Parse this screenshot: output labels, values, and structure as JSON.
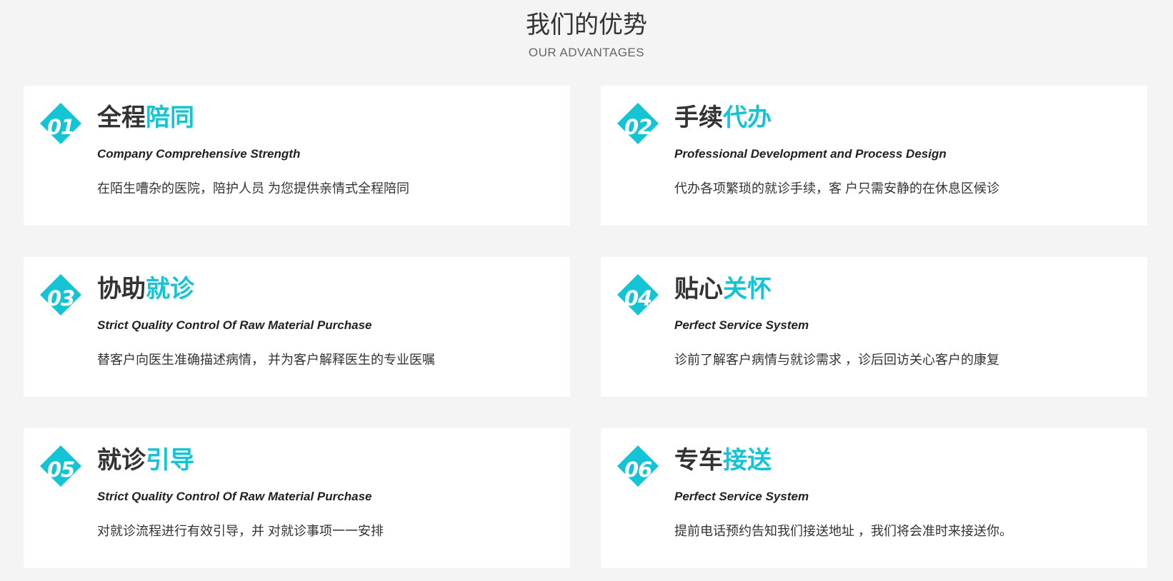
{
  "section": {
    "title": "我们的优势",
    "subtitle": "OUR ADVANTAGES"
  },
  "colors": {
    "accent": "#13c4d4",
    "background": "#f4f4f4",
    "card": "#ffffff",
    "text": "#333333"
  },
  "cards": [
    {
      "number": "01",
      "title_dark": "全程",
      "title_accent": "陪同",
      "subtitle_en": "Company Comprehensive Strength",
      "description": "在陌生嘈杂的医院，陪护人员 为您提供亲情式全程陪同"
    },
    {
      "number": "02",
      "title_dark": "手续",
      "title_accent": "代办",
      "subtitle_en": "Professional Development and Process Design",
      "description": "代办各项繁琐的就诊手续，客 户只需安静的在休息区候诊"
    },
    {
      "number": "03",
      "title_dark": "协助",
      "title_accent": "就诊",
      "subtitle_en": "Strict Quality Control Of Raw Material Purchase",
      "description": "替客户向医生准确描述病情， 并为客户解释医生的专业医嘱"
    },
    {
      "number": "04",
      "title_dark": "贴心",
      "title_accent": "关怀",
      "subtitle_en": "Perfect Service System",
      "description": "诊前了解客户病情与就诊需求 ，诊后回访关心客户的康复"
    },
    {
      "number": "05",
      "title_dark": "就诊",
      "title_accent": "引导",
      "subtitle_en": "Strict Quality Control Of Raw Material Purchase",
      "description": "对就诊流程进行有效引导，并 对就诊事项一一安排"
    },
    {
      "number": "06",
      "title_dark": "专车",
      "title_accent": "接送",
      "subtitle_en": "Perfect Service System",
      "description": "提前电话预约告知我们接送地址 ，我们将会准时来接送你。"
    }
  ]
}
